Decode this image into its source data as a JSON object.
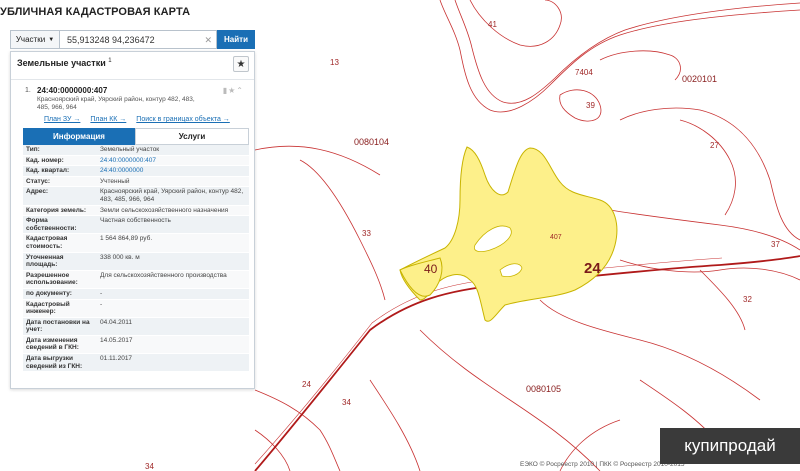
{
  "app": {
    "title": "УБЛИЧНАЯ КАДАСТРОВАЯ КАРТА"
  },
  "search": {
    "type_label": "Участки",
    "query": "55,913248 94,236472",
    "find_label": "Найти"
  },
  "panel": {
    "title": "Земельные участки",
    "count": "1",
    "result": {
      "index": "1.",
      "id": "24:40:0000000:407",
      "address": "Красноярский край, Уярский район, контур 482, 483, 485, 966, 964"
    },
    "links": [
      "План ЗУ →",
      "План КК →",
      "Поиск в границах объекта →"
    ],
    "tabs": [
      "Информация",
      "Услуги"
    ],
    "rows": [
      {
        "label": "Тип:",
        "value": "Земельный участок"
      },
      {
        "label": "Кад. номер:",
        "value": "24:40:0000000:407"
      },
      {
        "label": "Кад. квартал:",
        "value": "24:40:0000000"
      },
      {
        "label": "Статус:",
        "value": "Учтенный"
      },
      {
        "label": "Адрес:",
        "value": "Красноярский край, Уярский район, контур 482, 483, 485, 966, 964"
      },
      {
        "label": "Категория земель:",
        "value": "Земли сельскохозяйственного назначения"
      },
      {
        "label": "Форма собственности:",
        "value": "Частная собственность"
      },
      {
        "label": "Кадастровая стоимость:",
        "value": "1 564 864,89 руб."
      },
      {
        "label": "Уточненная площадь:",
        "value": "338 000 кв. м"
      },
      {
        "label": "Разрешенное использование:",
        "value": "Для сельскохозяйственного производства"
      },
      {
        "label": "по документу:",
        "value": "-"
      },
      {
        "label": "Кадастровый инженер:",
        "value": "-"
      },
      {
        "label": "Дата постановки на учет:",
        "value": "04.04.2011"
      },
      {
        "label": "Дата изменения сведений в ГКН:",
        "value": "14.05.2017"
      },
      {
        "label": "Дата выгрузки сведений из ГКН:",
        "value": "01.11.2017"
      }
    ]
  },
  "map": {
    "labels": {
      "l41": "41",
      "l13": "13",
      "l7404": "7404",
      "l39": "39",
      "l0020101": "0020101",
      "l0080104": "0080104",
      "l27": "27",
      "l33": "33",
      "l407": "407",
      "l40": "40",
      "l24": "24",
      "l37": "37",
      "l32": "32",
      "l24b": "24",
      "l34": "34",
      "l0080105": "0080105",
      "l34b": "34"
    },
    "colors": {
      "parcel_fill": "#fdf08a",
      "parcel_stroke": "#c8b400",
      "boundary": "#c83232",
      "road": "#b01a1a"
    }
  },
  "footer": {
    "copyright": "ЕЭКО © Росреестр 2010 | ПКК © Росреестр 2010-2015",
    "watermark": "купипродай"
  }
}
